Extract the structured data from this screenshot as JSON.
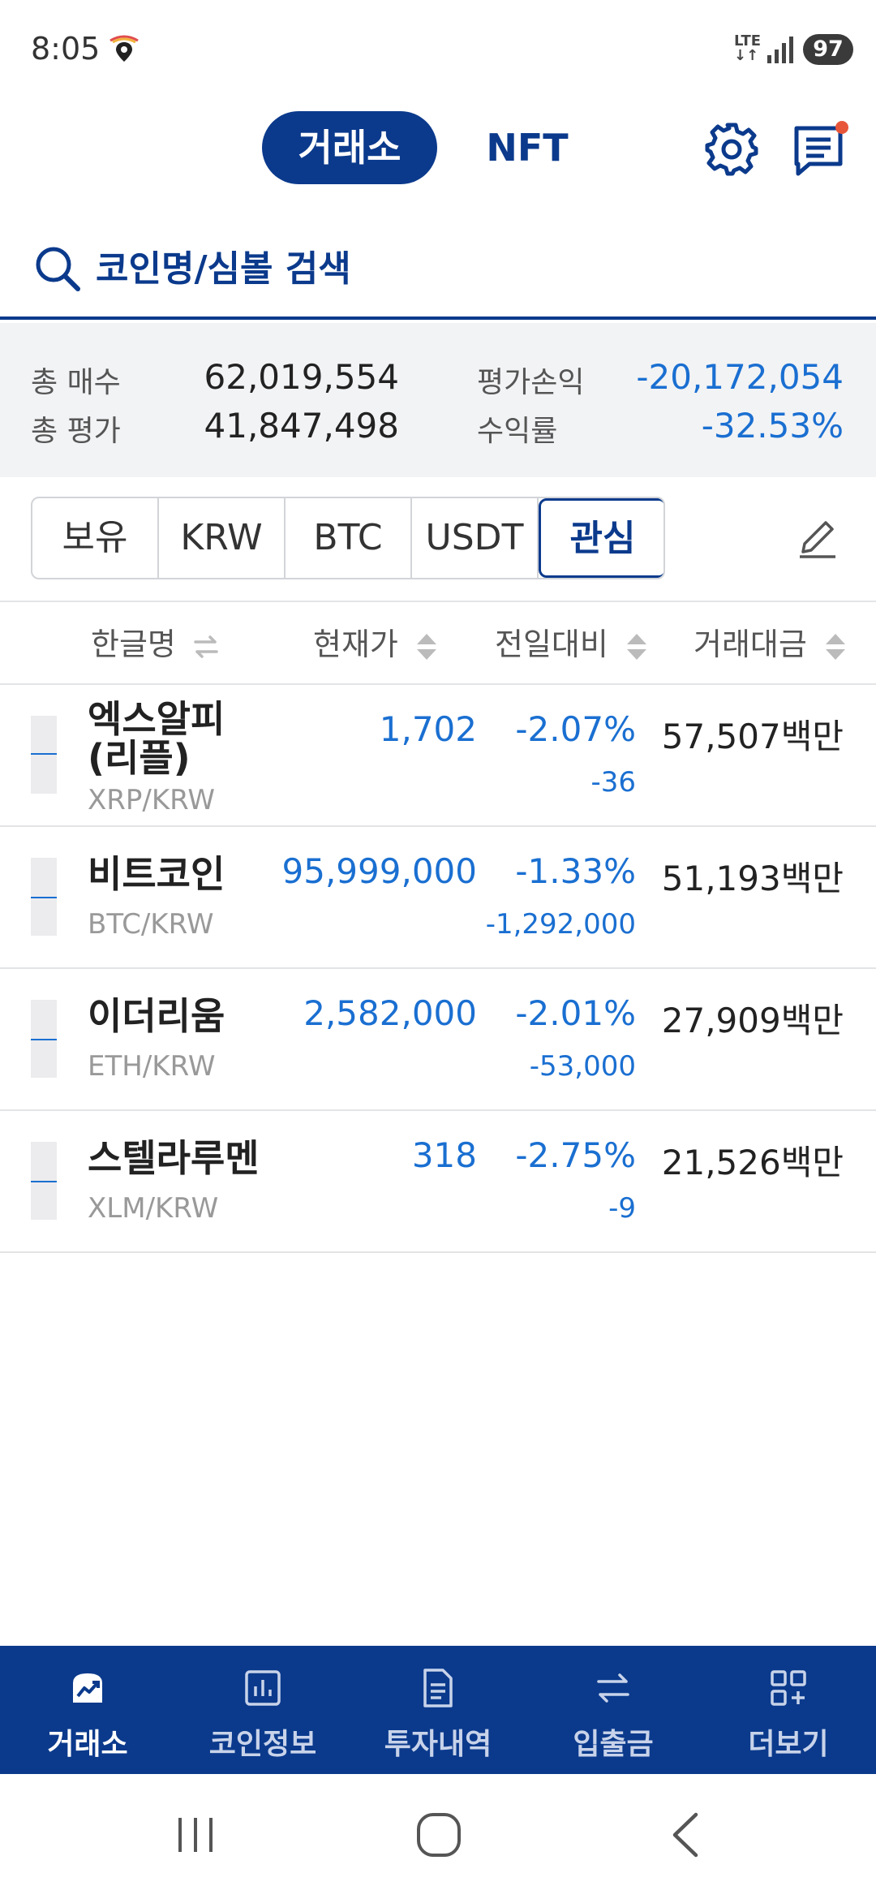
{
  "status_bar": {
    "time": "8:05",
    "network": "LTE",
    "battery": "97"
  },
  "header": {
    "tabs": [
      {
        "label": "거래소",
        "active": true
      },
      {
        "label": "NFT",
        "active": false
      }
    ],
    "settings_icon": "gear-icon",
    "messages_icon": "message-icon",
    "notification_dot_color": "#e8563a"
  },
  "search": {
    "placeholder": "코인명/심볼 검색"
  },
  "summary": {
    "total_buy_label": "총 매수",
    "total_buy_value": "62,019,554",
    "total_eval_label": "총 평가",
    "total_eval_value": "41,847,498",
    "pnl_label": "평가손익",
    "pnl_value": "-20,172,054",
    "return_label": "수익률",
    "return_value": "-32.53%"
  },
  "category_tabs": [
    {
      "label": "보유",
      "active": false
    },
    {
      "label": "KRW",
      "active": false
    },
    {
      "label": "BTC",
      "active": false
    },
    {
      "label": "USDT",
      "active": false
    },
    {
      "label": "관심",
      "active": true
    }
  ],
  "columns": {
    "name": "한글명",
    "price": "현재가",
    "change": "전일대비",
    "volume": "거래대금"
  },
  "coins": [
    {
      "name_line1": "엑스알피",
      "name_line2": "(리플)",
      "pair": "XRP/KRW",
      "price": "1,702",
      "change_pct": "-2.07%",
      "change_abs": "-36",
      "volume": "57,507백만"
    },
    {
      "name_line1": "비트코인",
      "name_line2": "",
      "pair": "BTC/KRW",
      "price": "95,999,000",
      "change_pct": "-1.33%",
      "change_abs": "-1,292,000",
      "volume": "51,193백만"
    },
    {
      "name_line1": "이더리움",
      "name_line2": "",
      "pair": "ETH/KRW",
      "price": "2,582,000",
      "change_pct": "-2.01%",
      "change_abs": "-53,000",
      "volume": "27,909백만"
    },
    {
      "name_line1": "스텔라루멘",
      "name_line2": "",
      "pair": "XLM/KRW",
      "price": "318",
      "change_pct": "-2.75%",
      "change_abs": "-9",
      "volume": "21,526백만"
    }
  ],
  "bottom_nav": [
    {
      "label": "거래소",
      "icon": "exchange-icon",
      "active": true
    },
    {
      "label": "코인정보",
      "icon": "chart-icon",
      "active": false
    },
    {
      "label": "투자내역",
      "icon": "document-icon",
      "active": false
    },
    {
      "label": "입출금",
      "icon": "transfer-icon",
      "active": false
    },
    {
      "label": "더보기",
      "icon": "more-grid-icon",
      "active": false
    }
  ],
  "colors": {
    "brand_navy": "#0b3a8c",
    "price_blue": "#1a6fd1"
  }
}
